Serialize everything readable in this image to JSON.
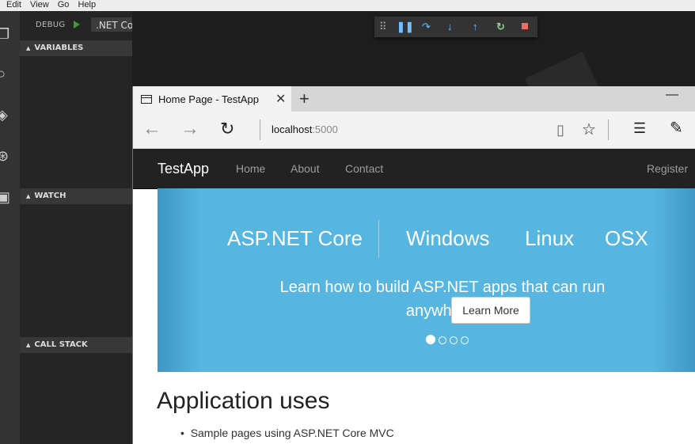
{
  "menubar": {
    "items": [
      "Edit",
      "View",
      "Go",
      "Help"
    ]
  },
  "debug": {
    "label": "DEBUG",
    "config": ".NET Core Laur",
    "sections": {
      "variables": "VARIABLES",
      "watch": "WATCH",
      "call_stack": "CALL STACK"
    }
  },
  "browser": {
    "tab_title": "Home Page - TestApp",
    "url_host": "localhost",
    "url_port": ":5000"
  },
  "site": {
    "brand": "TestApp",
    "nav": [
      "Home",
      "About",
      "Contact"
    ],
    "register": "Register",
    "carousel": {
      "headline": "ASP.NET Core",
      "platforms": [
        "Windows",
        "Linux",
        "OSX"
      ],
      "text": "Learn how to build ASP.NET apps that can run anywhere.",
      "button": "Learn More",
      "slides": 4,
      "active_slide": 1
    },
    "section_title": "Application uses",
    "bullets": [
      "Sample pages using ASP.NET Core MVC"
    ]
  },
  "colors": {
    "carousel_bg": "#56b6e0",
    "navbar_bg": "#222222",
    "play_green": "#3c9a3c",
    "stop_red": "#f06a6a"
  }
}
